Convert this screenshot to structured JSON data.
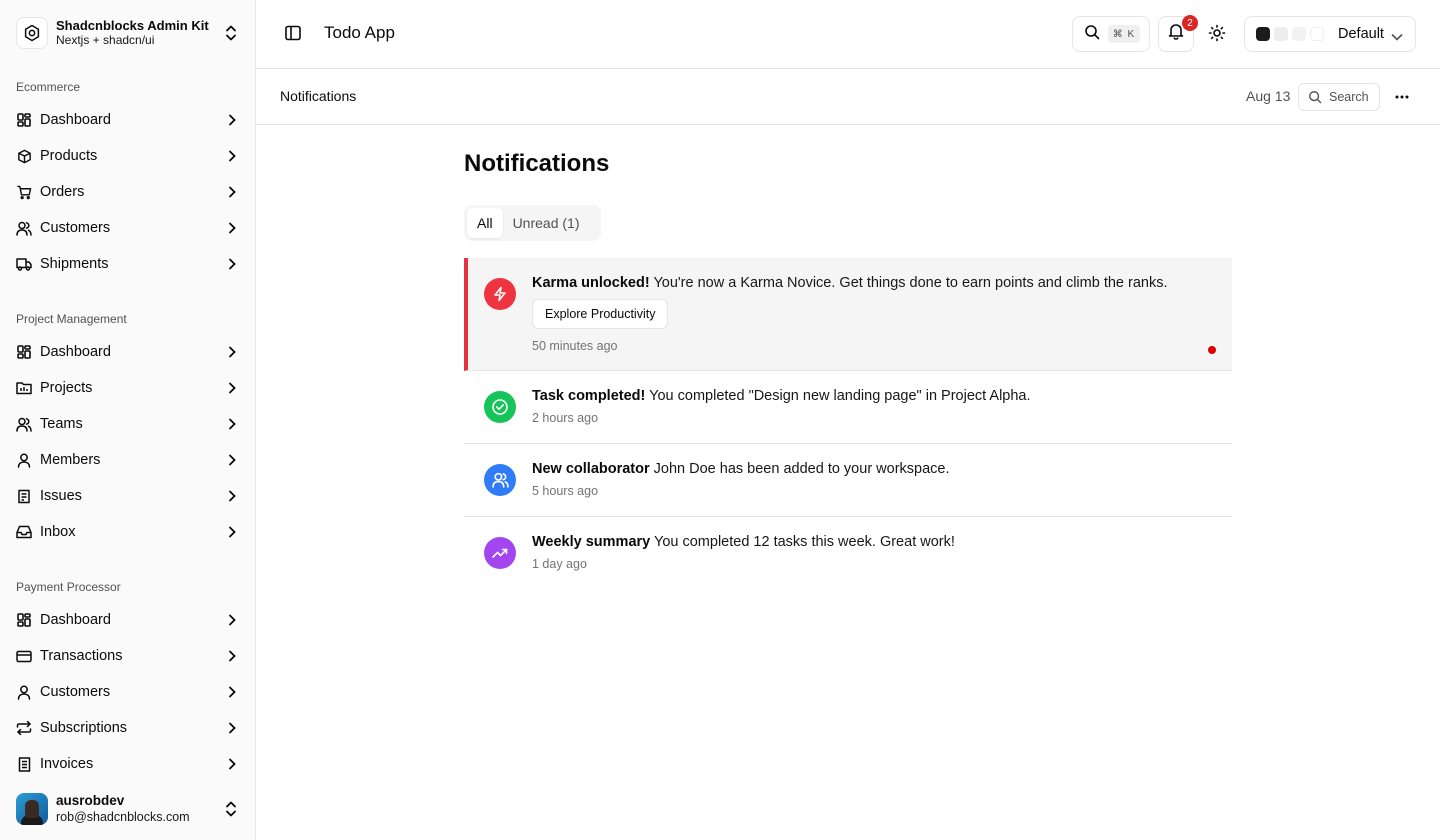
{
  "brand": {
    "title": "Shadcnblocks Admin Kit",
    "subtitle": "Nextjs + shadcn/ui"
  },
  "sidebar": {
    "groups": [
      {
        "label": "Ecommerce",
        "items": [
          {
            "label": "Dashboard",
            "icon": "dashboard-icon"
          },
          {
            "label": "Products",
            "icon": "package-icon"
          },
          {
            "label": "Orders",
            "icon": "cart-icon"
          },
          {
            "label": "Customers",
            "icon": "users-icon"
          },
          {
            "label": "Shipments",
            "icon": "truck-icon"
          }
        ]
      },
      {
        "label": "Project Management",
        "items": [
          {
            "label": "Dashboard",
            "icon": "dashboard-icon"
          },
          {
            "label": "Projects",
            "icon": "folder-icon"
          },
          {
            "label": "Teams",
            "icon": "users-icon"
          },
          {
            "label": "Members",
            "icon": "user-icon"
          },
          {
            "label": "Issues",
            "icon": "clipboard-icon"
          },
          {
            "label": "Inbox",
            "icon": "inbox-icon"
          }
        ]
      },
      {
        "label": "Payment Processor",
        "items": [
          {
            "label": "Dashboard",
            "icon": "dashboard-icon"
          },
          {
            "label": "Transactions",
            "icon": "credit-card-icon"
          },
          {
            "label": "Customers",
            "icon": "user-icon"
          },
          {
            "label": "Subscriptions",
            "icon": "repeat-icon"
          },
          {
            "label": "Invoices",
            "icon": "receipt-icon"
          }
        ]
      }
    ]
  },
  "user": {
    "name": "ausrobdev",
    "email": "rob@shadcnblocks.com"
  },
  "header": {
    "app_title": "Todo App",
    "search_shortcut": "⌘ K",
    "notification_count": "2",
    "theme_preset": "Default",
    "swatches": [
      "#1c1c1c",
      "#ededed",
      "#f2f2f2",
      "#ffffff"
    ]
  },
  "subheader": {
    "breadcrumb": "Notifications",
    "date": "Aug 13",
    "search_label": "Search"
  },
  "main": {
    "title": "Notifications",
    "tabs": [
      {
        "label": "All"
      },
      {
        "label": "Unread (1)"
      }
    ],
    "notifications": [
      {
        "title": "Karma unlocked!",
        "body": "You're now a Karma Novice. Get things done to earn points and climb the ranks.",
        "time": "50 minutes ago",
        "action": "Explore Productivity",
        "icon": "zap-icon",
        "color": "#ef3340",
        "unread": true
      },
      {
        "title": "Task completed!",
        "body": "You completed \"Design new landing page\" in Project Alpha.",
        "time": "2 hours ago",
        "icon": "check-circle-icon",
        "color": "#16c45a"
      },
      {
        "title": "New collaborator",
        "body": "John Doe has been added to your workspace.",
        "time": "5 hours ago",
        "icon": "users-icon",
        "color": "#2f7cf6"
      },
      {
        "title": "Weekly summary",
        "body": "You completed 12 tasks this week. Great work!",
        "time": "1 day ago",
        "icon": "trending-up-icon",
        "color": "#a346f0"
      }
    ]
  }
}
